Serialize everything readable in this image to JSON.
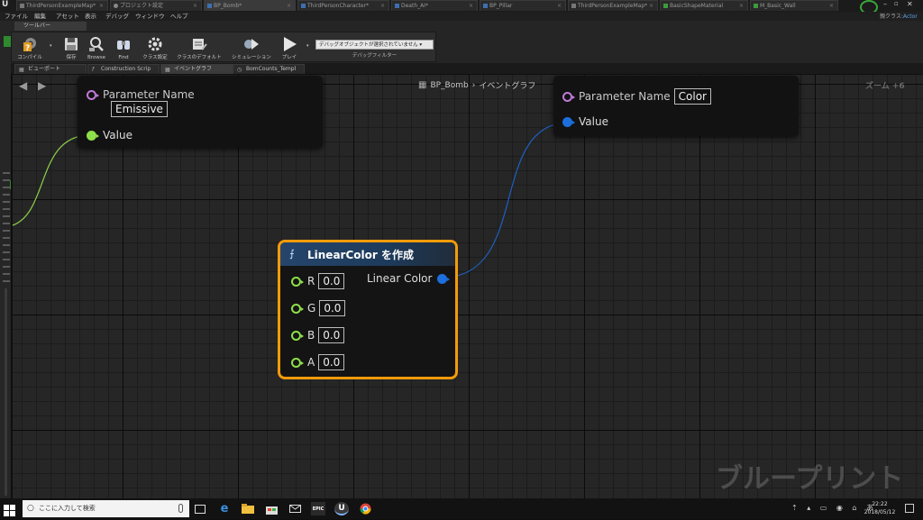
{
  "doc_tabs": [
    "ThirdPersonExampleMap*",
    "プロジェクト設定",
    "BP_Bomb*",
    "ThirdPersonCharacter*",
    "Death_AI*",
    "BP_Pillar",
    "ThirdPersonExampleMap*",
    "BasicShapeMaterial",
    "M_Basic_Wall"
  ],
  "menu": [
    "ファイル",
    "編集",
    "アセット",
    "表示",
    "デバッグ",
    "ウィンドウ",
    "ヘルプ"
  ],
  "parent_class": {
    "label": "親クラス:",
    "value": "Actor"
  },
  "toolbar_tab": "ツールバー",
  "toolbar": {
    "compile": "コンパイル",
    "save": "保存",
    "browse": "Browse",
    "find": "Find",
    "class_settings": "クラス設定",
    "class_defaults": "クラスのデフォルト",
    "simulation": "シミュレーション",
    "play": "プレイ",
    "debug_select": "デバッグオブジェクトが選択されていません",
    "debug_filter": "デバッグフィルター"
  },
  "sub_tabs": [
    "ビューポート",
    "Construction Scrip",
    "イベントグラフ",
    "BomCounts_Templ"
  ],
  "breadcrumb": {
    "blueprint": "BP_Bomb",
    "graph": "イベントグラフ"
  },
  "zoom_label": "ズーム +6",
  "watermark": "ブループリント",
  "nodes": {
    "left_param": {
      "param_label": "Parameter Name",
      "param_value": "Emissive",
      "value_label": "Value"
    },
    "right_param": {
      "param_label": "Parameter Name",
      "param_value": "Color",
      "value_label": "Value"
    },
    "make_color": {
      "title": "LinearColor を作成",
      "inputs": [
        {
          "name": "R",
          "value": "0.0"
        },
        {
          "name": "G",
          "value": "0.0"
        },
        {
          "name": "B",
          "value": "0.0"
        },
        {
          "name": "A",
          "value": "0.0"
        }
      ],
      "output": "Linear Color"
    }
  },
  "taskbar": {
    "search_placeholder": "ここに入力して検索",
    "time": "22:22",
    "date": "2018/05/12"
  },
  "colors": {
    "accent_selected": "#f39b0a",
    "float_pin": "#8ee04a",
    "name_pin": "#c07ad8",
    "struct_pin": "#1c6fdc",
    "header": "#26456b"
  }
}
